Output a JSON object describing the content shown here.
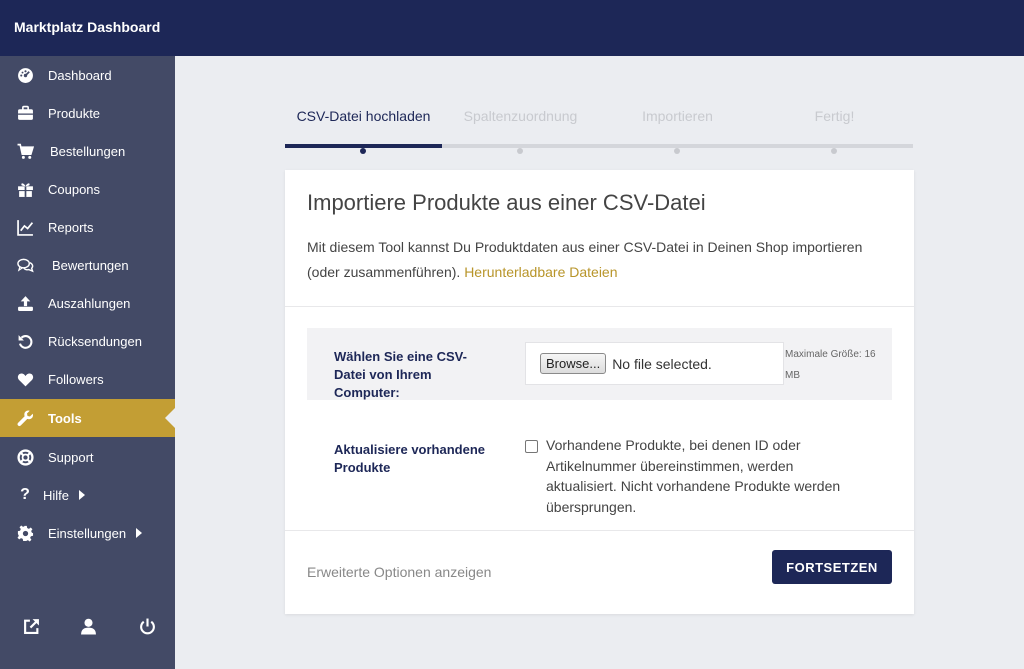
{
  "app": {
    "title": "Marktplatz Dashboard"
  },
  "sidebar": {
    "items": [
      {
        "label": "Dashboard",
        "icon": "dashboard-icon"
      },
      {
        "label": "Produkte",
        "icon": "briefcase-icon"
      },
      {
        "label": "Bestellungen",
        "icon": "cart-icon"
      },
      {
        "label": "Coupons",
        "icon": "gift-icon"
      },
      {
        "label": "Reports",
        "icon": "chart-line-icon"
      },
      {
        "label": "Bewertungen",
        "icon": "comments-icon"
      },
      {
        "label": "Auszahlungen",
        "icon": "upload-icon"
      },
      {
        "label": "Rücksendungen",
        "icon": "undo-icon"
      },
      {
        "label": "Followers",
        "icon": "heart-icon"
      },
      {
        "label": "Tools",
        "icon": "wrench-icon",
        "active": true
      },
      {
        "label": "Support",
        "icon": "lifebuoy-icon"
      },
      {
        "label": "Hilfe",
        "icon": "question-icon"
      },
      {
        "label": "Einstellungen",
        "icon": "gear-icon"
      }
    ],
    "bottom_icons": [
      "external-link-icon",
      "user-icon",
      "power-icon"
    ]
  },
  "steps": [
    {
      "label": "CSV-Datei hochladen",
      "active": true
    },
    {
      "label": "Spaltenzuordnung",
      "active": false
    },
    {
      "label": "Importieren",
      "active": false
    },
    {
      "label": "Fertig!",
      "active": false
    }
  ],
  "card": {
    "title": "Importiere Produkte aus einer CSV-Datei",
    "description": "Mit diesem Tool kannst Du Produktdaten aus einer CSV-Datei in Deinen Shop importieren (oder zusammenführen).",
    "link_text": "Herunterladbare Dateien",
    "upload_label": "Wählen Sie eine CSV-Datei von Ihrem Computer:",
    "browse_label": "Browse...",
    "file_status": "No file selected.",
    "max_size": "Maximale Größe: 16 MB",
    "update_label": "Aktualisiere vorhandene Produkte",
    "update_text": "Vorhandene Produkte, bei denen ID oder Artikelnummer übereinstimmen, werden aktualisiert. Nicht vorhandene Produkte werden übersprungen.",
    "update_checked": false,
    "advanced_label": "Erweiterte Optionen anzeigen",
    "continue_label": "FORTSETZEN"
  },
  "colors": {
    "header": "#1d2757",
    "sidebar": "#434a66",
    "accent": "#c39e34",
    "link": "#b8952a"
  }
}
